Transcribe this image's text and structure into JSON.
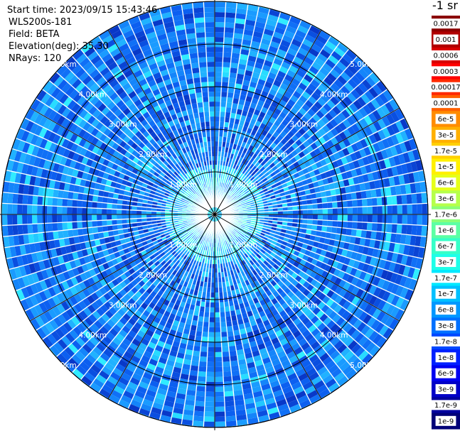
{
  "info": {
    "start_time": "Start time: 2023/09/15 15:43:46",
    "site": "WLS200s-181",
    "field": "Field: BETA",
    "elevation": "Elevation(deg): 35.30",
    "nrays": "NRays: 120"
  },
  "units_label": "-1 sr",
  "chart_data": {
    "type": "heatmap",
    "projection": "polar PPI",
    "field": "BETA",
    "elevation_deg": 35.3,
    "n_rays": 120,
    "range_rings_km": [
      1.0,
      2.0,
      3.0,
      4.0,
      5.0
    ],
    "ring_labels": [
      "1.00km",
      "2.00km",
      "3.00km",
      "4.00km",
      "5.00km"
    ],
    "spokes_deg": [
      0,
      30,
      60,
      90,
      120,
      150,
      180,
      210,
      240,
      270,
      300,
      330
    ],
    "colorbar": {
      "orientation": "vertical",
      "scale": "log",
      "range": [
        1e-09,
        0.0017
      ],
      "labels": [
        "0.0017",
        "0.001",
        "0.0006",
        "0.0003",
        "0.00017",
        "0.0001",
        "6e-5",
        "3e-5",
        "1.7e-5",
        "1e-5",
        "6e-6",
        "3e-6",
        "1.7e-6",
        "1e-6",
        "6e-7",
        "3e-7",
        "1.7e-7",
        "1e-7",
        "6e-8",
        "3e-8",
        "1.7e-8",
        "1e-8",
        "6e-9",
        "3e-9",
        "1.7e-9",
        "1e-9"
      ],
      "colors": [
        "#8b0000",
        "#b00000",
        "#d80000",
        "#ff0000",
        "#ff2a00",
        "#ff6000",
        "#ff8c00",
        "#ffb000",
        "#ffd000",
        "#fff000",
        "#e6ff1a",
        "#b6ff4a",
        "#8aff78",
        "#5cffa4",
        "#36ffc8",
        "#1effe8",
        "#00e8ff",
        "#00c0ff",
        "#0098ff",
        "#0070ff",
        "#0048ff",
        "#0020ff",
        "#0000f0",
        "#0000c8",
        "#00009e",
        "#000078"
      ]
    }
  }
}
